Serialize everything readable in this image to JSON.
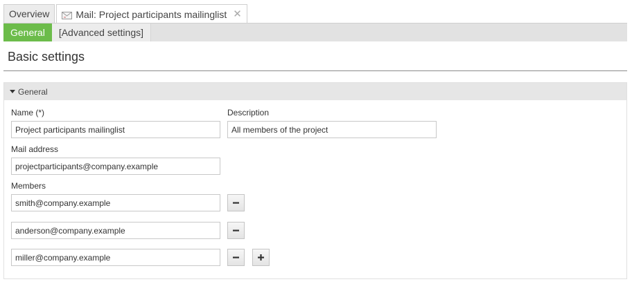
{
  "doc_tabs": {
    "overview_label": "Overview",
    "mail_label": "Mail: Project participants mailinglist",
    "close_glyph": "✕"
  },
  "sub_tabs": {
    "general_label": "General",
    "advanced_label": "[Advanced settings]"
  },
  "section": {
    "title": "Basic settings"
  },
  "panel": {
    "header_label": "General",
    "name_label": "Name (*)",
    "name_value": "Project participants mailinglist",
    "description_label": "Description",
    "description_value": "All members of the project",
    "mail_label": "Mail address",
    "mail_value": "projectparticipants@company.example",
    "members_label": "Members",
    "members": [
      "smith@company.example",
      "anderson@company.example",
      "miller@company.example"
    ]
  },
  "colors": {
    "accent_green": "#6cbc4a"
  },
  "icons": {
    "tab_icon": "mail-icon",
    "remove": "minus-icon",
    "add": "plus-icon",
    "collapse": "caret-down-icon"
  }
}
